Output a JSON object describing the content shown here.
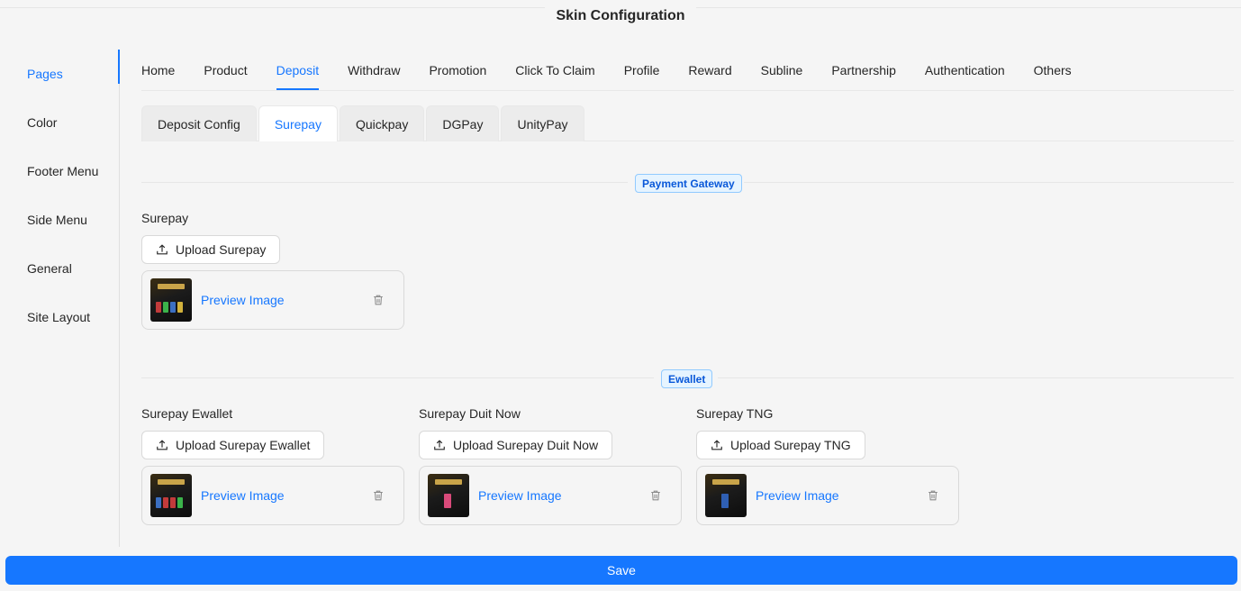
{
  "header": {
    "title": "Skin Configuration"
  },
  "sidebar": {
    "items": [
      {
        "label": "Pages",
        "active": true
      },
      {
        "label": "Color"
      },
      {
        "label": "Footer Menu"
      },
      {
        "label": "Side Menu"
      },
      {
        "label": "General"
      },
      {
        "label": "Site Layout"
      }
    ]
  },
  "tabs": {
    "main": [
      "Home",
      "Product",
      "Deposit",
      "Withdraw",
      "Promotion",
      "Click To Claim",
      "Profile",
      "Reward",
      "Subline",
      "Partnership",
      "Authentication",
      "Others"
    ],
    "main_active": "Deposit",
    "sub": [
      "Deposit Config",
      "Surepay",
      "Quickpay",
      "DGPay",
      "UnityPay"
    ],
    "sub_active": "Surepay"
  },
  "sections": {
    "payment_gateway": {
      "title": "Payment Gateway",
      "fields": [
        {
          "label": "Surepay",
          "upload_label": "Upload Surepay",
          "preview_label": "Preview Image"
        }
      ]
    },
    "ewallet": {
      "title": "Ewallet",
      "fields": [
        {
          "label": "Surepay Ewallet",
          "upload_label": "Upload Surepay Ewallet",
          "preview_label": "Preview Image"
        },
        {
          "label": "Surepay Duit Now",
          "upload_label": "Upload Surepay Duit Now",
          "preview_label": "Preview Image"
        },
        {
          "label": "Surepay TNG",
          "upload_label": "Upload Surepay TNG",
          "preview_label": "Preview Image"
        }
      ]
    }
  },
  "footer": {
    "save_label": "Save"
  },
  "colors": {
    "primary": "#1677ff",
    "badge_text": "#0958d9",
    "badge_bg": "#e6f4ff",
    "page_bg": "#f5f5f5"
  },
  "icons": {
    "upload": "upload-icon",
    "delete": "trash-icon"
  }
}
